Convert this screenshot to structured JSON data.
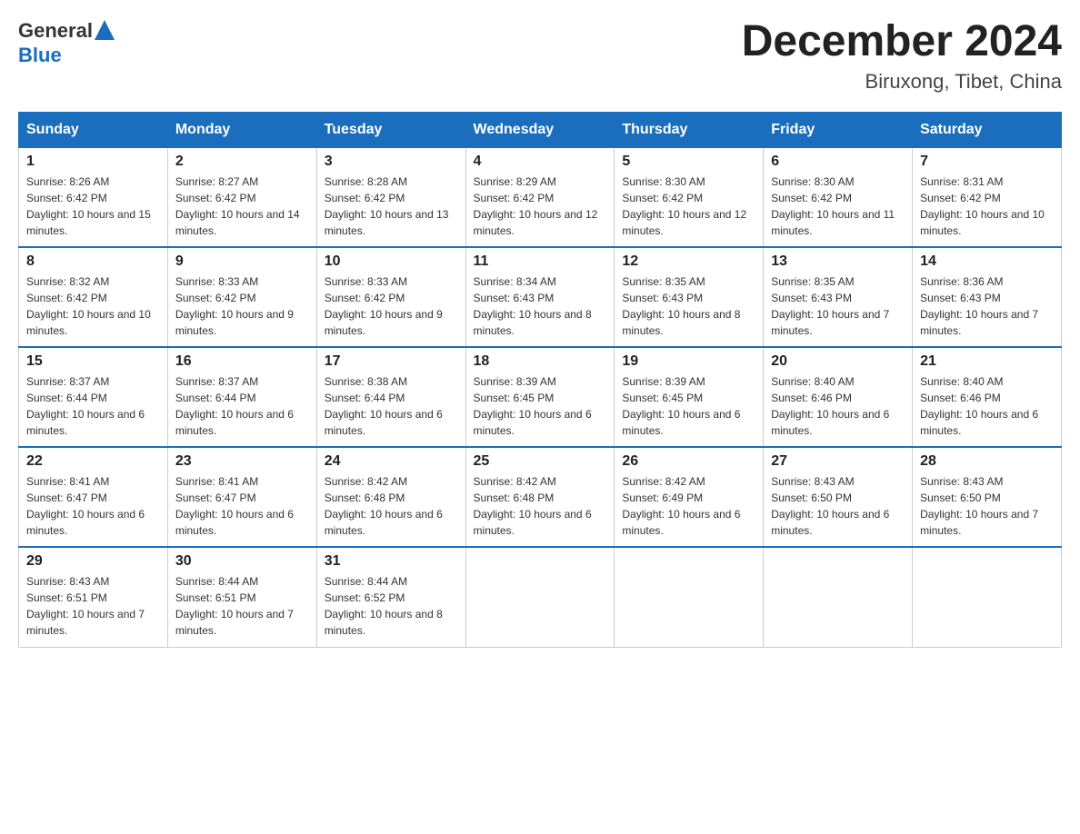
{
  "logo": {
    "text_general": "General",
    "text_blue": "Blue"
  },
  "title": "December 2024",
  "subtitle": "Biruxong, Tibet, China",
  "days_of_week": [
    "Sunday",
    "Monday",
    "Tuesday",
    "Wednesday",
    "Thursday",
    "Friday",
    "Saturday"
  ],
  "weeks": [
    [
      {
        "day": "1",
        "sunrise": "8:26 AM",
        "sunset": "6:42 PM",
        "daylight": "10 hours and 15 minutes."
      },
      {
        "day": "2",
        "sunrise": "8:27 AM",
        "sunset": "6:42 PM",
        "daylight": "10 hours and 14 minutes."
      },
      {
        "day": "3",
        "sunrise": "8:28 AM",
        "sunset": "6:42 PM",
        "daylight": "10 hours and 13 minutes."
      },
      {
        "day": "4",
        "sunrise": "8:29 AM",
        "sunset": "6:42 PM",
        "daylight": "10 hours and 12 minutes."
      },
      {
        "day": "5",
        "sunrise": "8:30 AM",
        "sunset": "6:42 PM",
        "daylight": "10 hours and 12 minutes."
      },
      {
        "day": "6",
        "sunrise": "8:30 AM",
        "sunset": "6:42 PM",
        "daylight": "10 hours and 11 minutes."
      },
      {
        "day": "7",
        "sunrise": "8:31 AM",
        "sunset": "6:42 PM",
        "daylight": "10 hours and 10 minutes."
      }
    ],
    [
      {
        "day": "8",
        "sunrise": "8:32 AM",
        "sunset": "6:42 PM",
        "daylight": "10 hours and 10 minutes."
      },
      {
        "day": "9",
        "sunrise": "8:33 AM",
        "sunset": "6:42 PM",
        "daylight": "10 hours and 9 minutes."
      },
      {
        "day": "10",
        "sunrise": "8:33 AM",
        "sunset": "6:42 PM",
        "daylight": "10 hours and 9 minutes."
      },
      {
        "day": "11",
        "sunrise": "8:34 AM",
        "sunset": "6:43 PM",
        "daylight": "10 hours and 8 minutes."
      },
      {
        "day": "12",
        "sunrise": "8:35 AM",
        "sunset": "6:43 PM",
        "daylight": "10 hours and 8 minutes."
      },
      {
        "day": "13",
        "sunrise": "8:35 AM",
        "sunset": "6:43 PM",
        "daylight": "10 hours and 7 minutes."
      },
      {
        "day": "14",
        "sunrise": "8:36 AM",
        "sunset": "6:43 PM",
        "daylight": "10 hours and 7 minutes."
      }
    ],
    [
      {
        "day": "15",
        "sunrise": "8:37 AM",
        "sunset": "6:44 PM",
        "daylight": "10 hours and 6 minutes."
      },
      {
        "day": "16",
        "sunrise": "8:37 AM",
        "sunset": "6:44 PM",
        "daylight": "10 hours and 6 minutes."
      },
      {
        "day": "17",
        "sunrise": "8:38 AM",
        "sunset": "6:44 PM",
        "daylight": "10 hours and 6 minutes."
      },
      {
        "day": "18",
        "sunrise": "8:39 AM",
        "sunset": "6:45 PM",
        "daylight": "10 hours and 6 minutes."
      },
      {
        "day": "19",
        "sunrise": "8:39 AM",
        "sunset": "6:45 PM",
        "daylight": "10 hours and 6 minutes."
      },
      {
        "day": "20",
        "sunrise": "8:40 AM",
        "sunset": "6:46 PM",
        "daylight": "10 hours and 6 minutes."
      },
      {
        "day": "21",
        "sunrise": "8:40 AM",
        "sunset": "6:46 PM",
        "daylight": "10 hours and 6 minutes."
      }
    ],
    [
      {
        "day": "22",
        "sunrise": "8:41 AM",
        "sunset": "6:47 PM",
        "daylight": "10 hours and 6 minutes."
      },
      {
        "day": "23",
        "sunrise": "8:41 AM",
        "sunset": "6:47 PM",
        "daylight": "10 hours and 6 minutes."
      },
      {
        "day": "24",
        "sunrise": "8:42 AM",
        "sunset": "6:48 PM",
        "daylight": "10 hours and 6 minutes."
      },
      {
        "day": "25",
        "sunrise": "8:42 AM",
        "sunset": "6:48 PM",
        "daylight": "10 hours and 6 minutes."
      },
      {
        "day": "26",
        "sunrise": "8:42 AM",
        "sunset": "6:49 PM",
        "daylight": "10 hours and 6 minutes."
      },
      {
        "day": "27",
        "sunrise": "8:43 AM",
        "sunset": "6:50 PM",
        "daylight": "10 hours and 6 minutes."
      },
      {
        "day": "28",
        "sunrise": "8:43 AM",
        "sunset": "6:50 PM",
        "daylight": "10 hours and 7 minutes."
      }
    ],
    [
      {
        "day": "29",
        "sunrise": "8:43 AM",
        "sunset": "6:51 PM",
        "daylight": "10 hours and 7 minutes."
      },
      {
        "day": "30",
        "sunrise": "8:44 AM",
        "sunset": "6:51 PM",
        "daylight": "10 hours and 7 minutes."
      },
      {
        "day": "31",
        "sunrise": "8:44 AM",
        "sunset": "6:52 PM",
        "daylight": "10 hours and 8 minutes."
      },
      null,
      null,
      null,
      null
    ]
  ]
}
